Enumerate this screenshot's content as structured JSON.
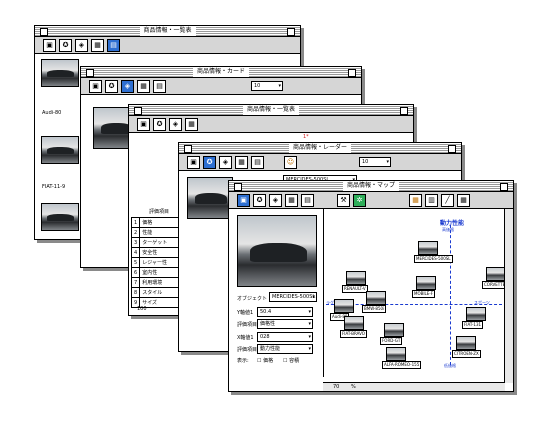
{
  "win1": {
    "title": "商品情報・一覧表",
    "items": [
      "Audi-80",
      "FIAT-11-9"
    ]
  },
  "win2": {
    "title": "商品情報・カード",
    "page": "10"
  },
  "win3": {
    "title": "商品情報・一覧表",
    "select": "MERCIDES-500SL",
    "column_mark": "1*",
    "eval_header": "評価項目",
    "rows": [
      [
        "1",
        "価格"
      ],
      [
        "2",
        "性能"
      ],
      [
        "3",
        "ターゲット"
      ],
      [
        "4",
        "安全性"
      ],
      [
        "5",
        "レジャー性"
      ],
      [
        "6",
        "室内性"
      ],
      [
        "7",
        "利用環境"
      ],
      [
        "8",
        "スタイル"
      ],
      [
        "9",
        "サイズ"
      ]
    ],
    "footer": "100"
  },
  "win4": {
    "title": "商品情報・レーダー",
    "select": "MERCIDES-500SL",
    "page": "10"
  },
  "win5": {
    "title": "商品情報・マップ",
    "object_label": "オブジェクト",
    "object_value": "MERCIDES-500SL",
    "axis1_label": "Y軸値1",
    "axis1_value": "50.4",
    "eval1_label": "評価項目",
    "eval1_value": "価格性",
    "axis2_label": "X軸値1",
    "axis2_value": "028",
    "eval2_label": "評価項目",
    "eval2_value": "動力性能",
    "display_label": "表示:",
    "opt1": "価格",
    "opt2": "容積",
    "map_title": "動力性能",
    "top_label": "高価格",
    "bottom_label": "低価格",
    "left_label": "ラグジュアリー",
    "right_label": "スポーツ",
    "zoom": "70",
    "zoom_unit": "%",
    "cars": [
      "MERCIDES-500SL",
      "RENAULT-V",
      "CORVETTE",
      "MOBILE-F",
      "BMW-850i",
      "CITROEN-ZX",
      "FIAT-131",
      "Audi-80",
      "FIAT-BRAVO",
      "FORD-GT",
      "ALFA-ROMEO-155"
    ]
  }
}
